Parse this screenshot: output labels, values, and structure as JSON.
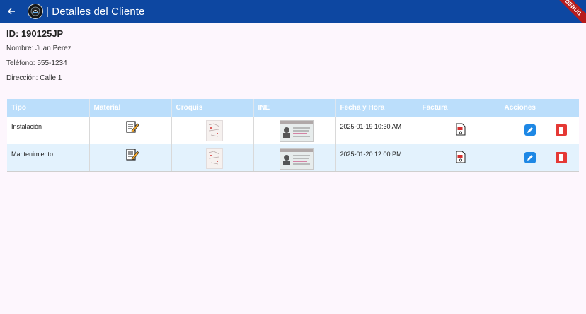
{
  "appbar": {
    "title": "| Detalles del Cliente",
    "debug_banner": "DEBUG"
  },
  "client": {
    "id": "ID: 190125JP",
    "name": "Nombre: Juan Perez",
    "phone": "Teléfono: 555-1234",
    "address": "Dirección: Calle 1"
  },
  "table": {
    "headers": [
      "Tipo",
      "Material",
      "Croquis",
      "INE",
      "Fecha y Hora",
      "Factura",
      "Acciones"
    ],
    "rows": [
      {
        "tipo": "Instalación",
        "fecha": "2025-01-19 10:30 AM"
      },
      {
        "tipo": "Mantenimiento",
        "fecha": "2025-01-20 12:00 PM"
      }
    ]
  },
  "colors": {
    "appbar": "#0d47a1",
    "header": "#bbdefb",
    "alt_row": "#e3f2fd",
    "edit": "#1e88e5",
    "delete": "#e53935"
  }
}
